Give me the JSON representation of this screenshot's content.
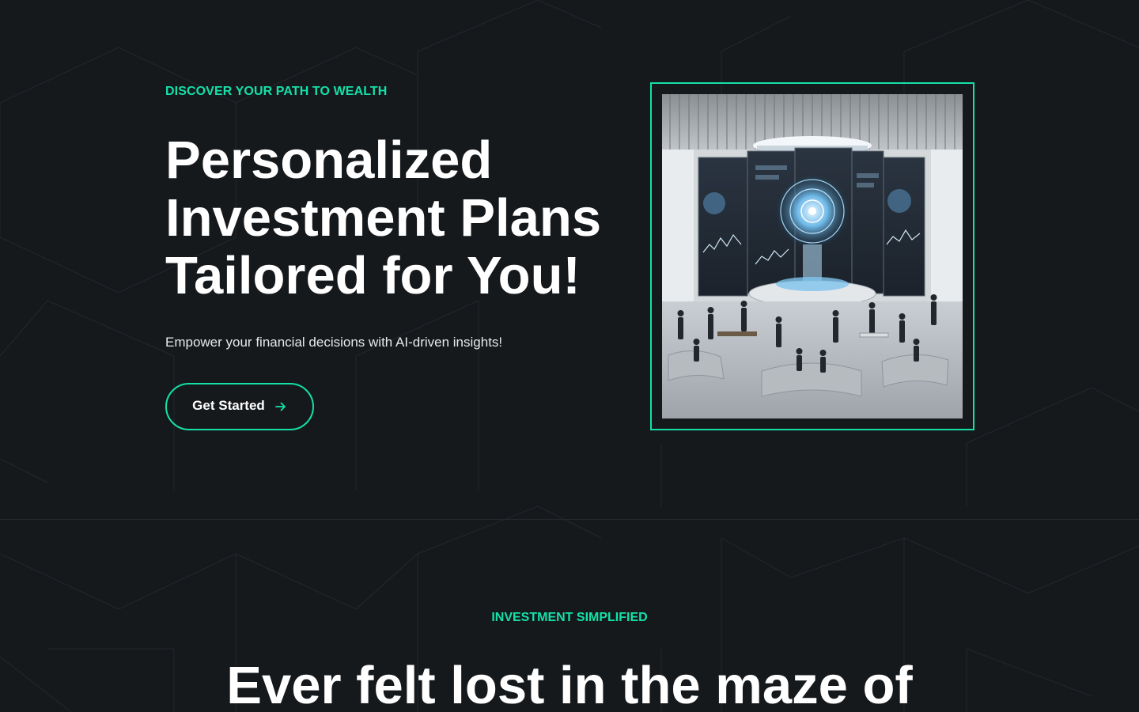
{
  "theme": {
    "accent": "#14e0a8",
    "background": "#16191c"
  },
  "hero": {
    "eyebrow": "DISCOVER YOUR PATH TO WEALTH",
    "headline_lines": [
      "Personalized",
      "Investment Plans",
      "Tailored for You!"
    ],
    "subtitle": "Empower your financial decisions with AI-driven insights!",
    "cta_label": "Get Started",
    "cta_icon": "arrow-right-icon",
    "image_alt": "AI investment command center illustration"
  },
  "section2": {
    "eyebrow": "INVESTMENT SIMPLIFIED",
    "headline": "Ever felt lost in the maze of"
  }
}
